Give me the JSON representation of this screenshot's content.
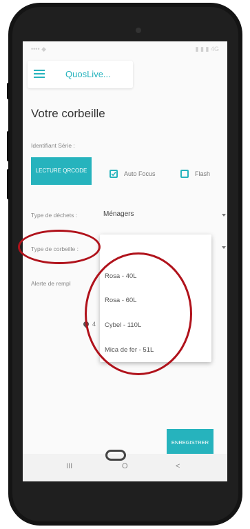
{
  "status": {
    "left": "•••• ◆",
    "right": "▮ ▮ ▮ 4G"
  },
  "header": {
    "app_name": "QuosLive..."
  },
  "page": {
    "title": "Votre corbeille"
  },
  "form": {
    "serial_label": "Identifiant Série :",
    "qr_button": "LECTURE QRCODE",
    "autofocus_label": "Auto Focus",
    "autofocus_checked": true,
    "flash_label": "Flash",
    "flash_checked": false,
    "waste_type_label": "Type de déchets :",
    "waste_type_value": "Ménagers",
    "bin_type_label": "Type de corbeille :",
    "alert_label": "Alerte de rempl",
    "location_text": "4",
    "save_button": "ENREGISTRER"
  },
  "dropdown": {
    "options": [
      "Rosa - 40L",
      "Rosa - 60L",
      "Cybel - 110L",
      "Mica de fer - 51L"
    ]
  },
  "navbar": {
    "recent": "III",
    "home": "O",
    "back": "<"
  },
  "colors": {
    "accent": "#26b3bd",
    "annotation": "#b0121b"
  }
}
